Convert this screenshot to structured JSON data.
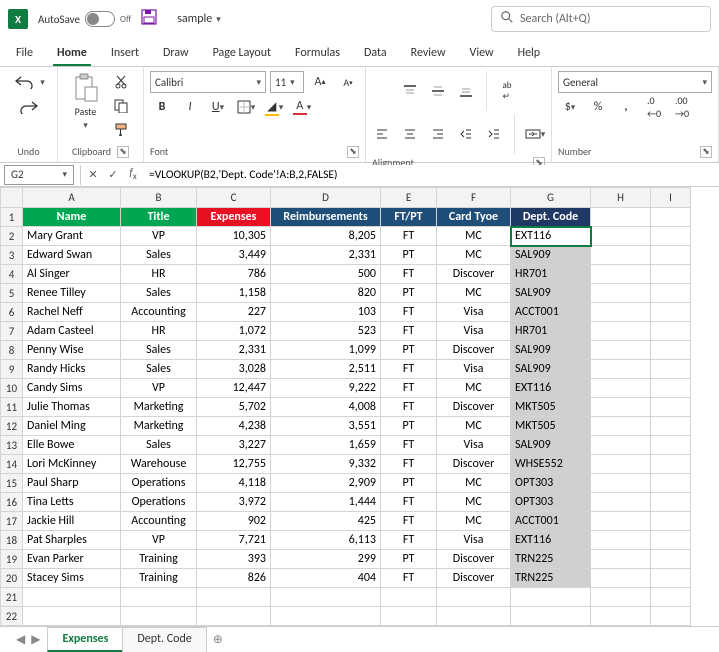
{
  "titlebar": {
    "autosave_label": "AutoSave",
    "autosave_state": "Off",
    "filename": "sample",
    "search_placeholder": "Search (Alt+Q)"
  },
  "menu_tabs": [
    "File",
    "Home",
    "Insert",
    "Draw",
    "Page Layout",
    "Formulas",
    "Data",
    "Review",
    "View",
    "Help"
  ],
  "active_menu_tab": "Home",
  "ribbon": {
    "undo_label": "Undo",
    "clipboard_label": "Clipboard",
    "paste_label": "Paste",
    "font_label": "Font",
    "font_name": "Calibri",
    "font_size": "11",
    "alignment_label": "Alignment",
    "number_label": "Number",
    "number_format": "General"
  },
  "namebox": "G2",
  "formula": "=VLOOKUP(B2,'Dept. Code'!A:B,2,FALSE)",
  "columns": [
    "A",
    "B",
    "C",
    "D",
    "E",
    "F",
    "G",
    "H",
    "I"
  ],
  "colwidths": [
    "col-A",
    "col-B",
    "col-C",
    "col-D",
    "col-E",
    "col-F",
    "col-G",
    "col-H",
    "col-I"
  ],
  "header_row": {
    "cells": [
      {
        "text": "Name",
        "cls": "green"
      },
      {
        "text": "Title",
        "cls": "green"
      },
      {
        "text": "Expenses",
        "cls": "red"
      },
      {
        "text": "Reimbursements",
        "cls": "blue"
      },
      {
        "text": "FT/PT",
        "cls": "blue"
      },
      {
        "text": "Card Tyoe",
        "cls": "blue"
      },
      {
        "text": "Dept. Code",
        "cls": "navy"
      }
    ]
  },
  "rows": [
    {
      "n": 2,
      "name": "Mary Grant",
      "title": "VP",
      "exp": "10,305",
      "reimb": "8,205",
      "ft": "FT",
      "card": "MC",
      "dept": "EXT116"
    },
    {
      "n": 3,
      "name": "Edward Swan",
      "title": "Sales",
      "exp": "3,449",
      "reimb": "2,331",
      "ft": "PT",
      "card": "MC",
      "dept": "SAL909"
    },
    {
      "n": 4,
      "name": "Al Singer",
      "title": "HR",
      "exp": "786",
      "reimb": "500",
      "ft": "FT",
      "card": "Discover",
      "dept": "HR701"
    },
    {
      "n": 5,
      "name": "Renee Tilley",
      "title": "Sales",
      "exp": "1,158",
      "reimb": "820",
      "ft": "PT",
      "card": "MC",
      "dept": "SAL909"
    },
    {
      "n": 6,
      "name": "Rachel Neff",
      "title": "Accounting",
      "exp": "227",
      "reimb": "103",
      "ft": "FT",
      "card": "Visa",
      "dept": "ACCT001"
    },
    {
      "n": 7,
      "name": "Adam Casteel",
      "title": "HR",
      "exp": "1,072",
      "reimb": "523",
      "ft": "FT",
      "card": "Visa",
      "dept": "HR701"
    },
    {
      "n": 8,
      "name": "Penny Wise",
      "title": "Sales",
      "exp": "2,331",
      "reimb": "1,099",
      "ft": "PT",
      "card": "Discover",
      "dept": "SAL909"
    },
    {
      "n": 9,
      "name": "Randy Hicks",
      "title": "Sales",
      "exp": "3,028",
      "reimb": "2,511",
      "ft": "FT",
      "card": "Visa",
      "dept": "SAL909"
    },
    {
      "n": 10,
      "name": "Candy Sims",
      "title": "VP",
      "exp": "12,447",
      "reimb": "9,222",
      "ft": "FT",
      "card": "MC",
      "dept": "EXT116"
    },
    {
      "n": 11,
      "name": "Julie Thomas",
      "title": "Marketing",
      "exp": "5,702",
      "reimb": "4,008",
      "ft": "FT",
      "card": "Discover",
      "dept": "MKT505"
    },
    {
      "n": 12,
      "name": "Daniel Ming",
      "title": "Marketing",
      "exp": "4,238",
      "reimb": "3,551",
      "ft": "PT",
      "card": "MC",
      "dept": "MKT505"
    },
    {
      "n": 13,
      "name": "Elle Bowe",
      "title": "Sales",
      "exp": "3,227",
      "reimb": "1,659",
      "ft": "FT",
      "card": "Visa",
      "dept": "SAL909"
    },
    {
      "n": 14,
      "name": "Lori McKinney",
      "title": "Warehouse",
      "exp": "12,755",
      "reimb": "9,332",
      "ft": "FT",
      "card": "Discover",
      "dept": "WHSE552"
    },
    {
      "n": 15,
      "name": "Paul Sharp",
      "title": "Operations",
      "exp": "4,118",
      "reimb": "2,909",
      "ft": "PT",
      "card": "MC",
      "dept": "OPT303"
    },
    {
      "n": 16,
      "name": "Tina Letts",
      "title": "Operations",
      "exp": "3,972",
      "reimb": "1,444",
      "ft": "FT",
      "card": "MC",
      "dept": "OPT303"
    },
    {
      "n": 17,
      "name": "Jackie Hill",
      "title": "Accounting",
      "exp": "902",
      "reimb": "425",
      "ft": "FT",
      "card": "MC",
      "dept": "ACCT001"
    },
    {
      "n": 18,
      "name": "Pat Sharples",
      "title": "VP",
      "exp": "7,721",
      "reimb": "6,113",
      "ft": "FT",
      "card": "Visa",
      "dept": "EXT116"
    },
    {
      "n": 19,
      "name": "Evan Parker",
      "title": "Training",
      "exp": "393",
      "reimb": "299",
      "ft": "PT",
      "card": "Discover",
      "dept": "TRN225"
    },
    {
      "n": 20,
      "name": "Stacey Sims",
      "title": "Training",
      "exp": "826",
      "reimb": "404",
      "ft": "FT",
      "card": "Discover",
      "dept": "TRN225"
    }
  ],
  "empty_rows": [
    21,
    22
  ],
  "sheet_tabs": [
    "Expenses",
    "Dept. Code"
  ],
  "active_sheet": "Expenses",
  "selected_col_letter": "G",
  "active_row": 2
}
